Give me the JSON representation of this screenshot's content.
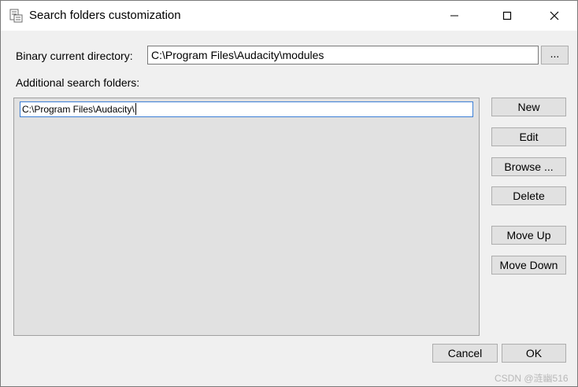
{
  "window": {
    "title": "Search folders customization",
    "controls": {
      "minimize": "minimize-icon",
      "maximize": "maximize-icon",
      "close": "close-icon"
    }
  },
  "binary": {
    "label": "Binary current directory:",
    "value": "C:\\Program Files\\Audacity\\modules",
    "browse_label": "..."
  },
  "additional": {
    "label": "Additional search folders:",
    "editing_value": "C:\\Program Files\\Audacity\\"
  },
  "buttons": {
    "new": "New",
    "edit": "Edit",
    "browse": "Browse ...",
    "delete": "Delete",
    "move_up": "Move Up",
    "move_down": "Move Down",
    "cancel": "Cancel",
    "ok": "OK"
  },
  "watermark": "CSDN @涟幽516"
}
